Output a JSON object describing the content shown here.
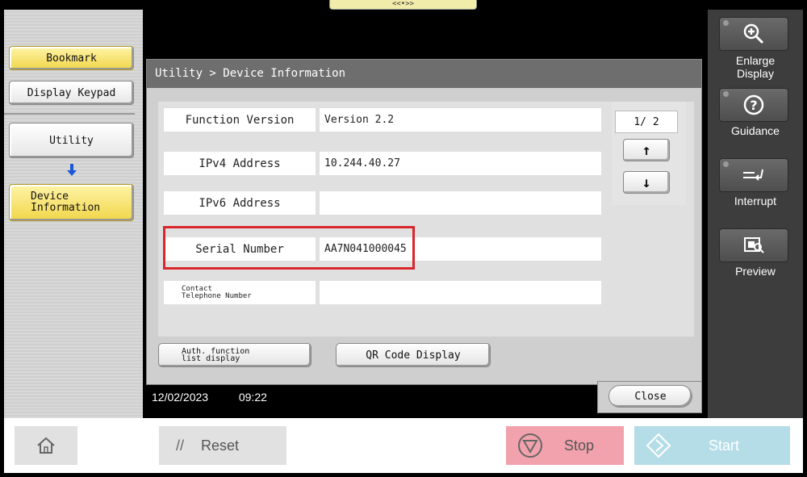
{
  "top_notch": "<<•>>",
  "left_panel": {
    "bookmark": "Bookmark",
    "display_keypad": "Display Keypad",
    "utility": "Utility",
    "device_information_line1": "Device",
    "device_information_line2": "Information"
  },
  "dialog": {
    "title": "Utility > Device Information",
    "rows": [
      {
        "label": "Function Version",
        "value": "Version 2.2"
      },
      {
        "label": "IPv4 Address",
        "value": "10.244.40.27"
      },
      {
        "label": "IPv6 Address",
        "value": ""
      },
      {
        "label": "Serial Number",
        "value": "AA7N041000045"
      },
      {
        "label_line1": "Contact",
        "label_line2": "Telephone Number",
        "value": ""
      }
    ],
    "page_indicator": "1/ 2",
    "auth_button_line1": "Auth. function",
    "auth_button_line2": "list display",
    "qr_button": "QR Code Display",
    "close_button": "Close"
  },
  "status": {
    "date": "12/02/2023",
    "time": "09:22"
  },
  "right_panel": {
    "enlarge_line1": "Enlarge",
    "enlarge_line2": "Display",
    "guidance": "Guidance",
    "interrupt": "Interrupt",
    "preview": "Preview"
  },
  "bottom_bar": {
    "reset": "Reset",
    "stop": "Stop",
    "start": "Start"
  },
  "colors": {
    "highlight": "#d9262c",
    "stop_bg": "#f2a2ad",
    "start_bg": "#b5dde8",
    "yellow_button": "#f1d64a"
  }
}
